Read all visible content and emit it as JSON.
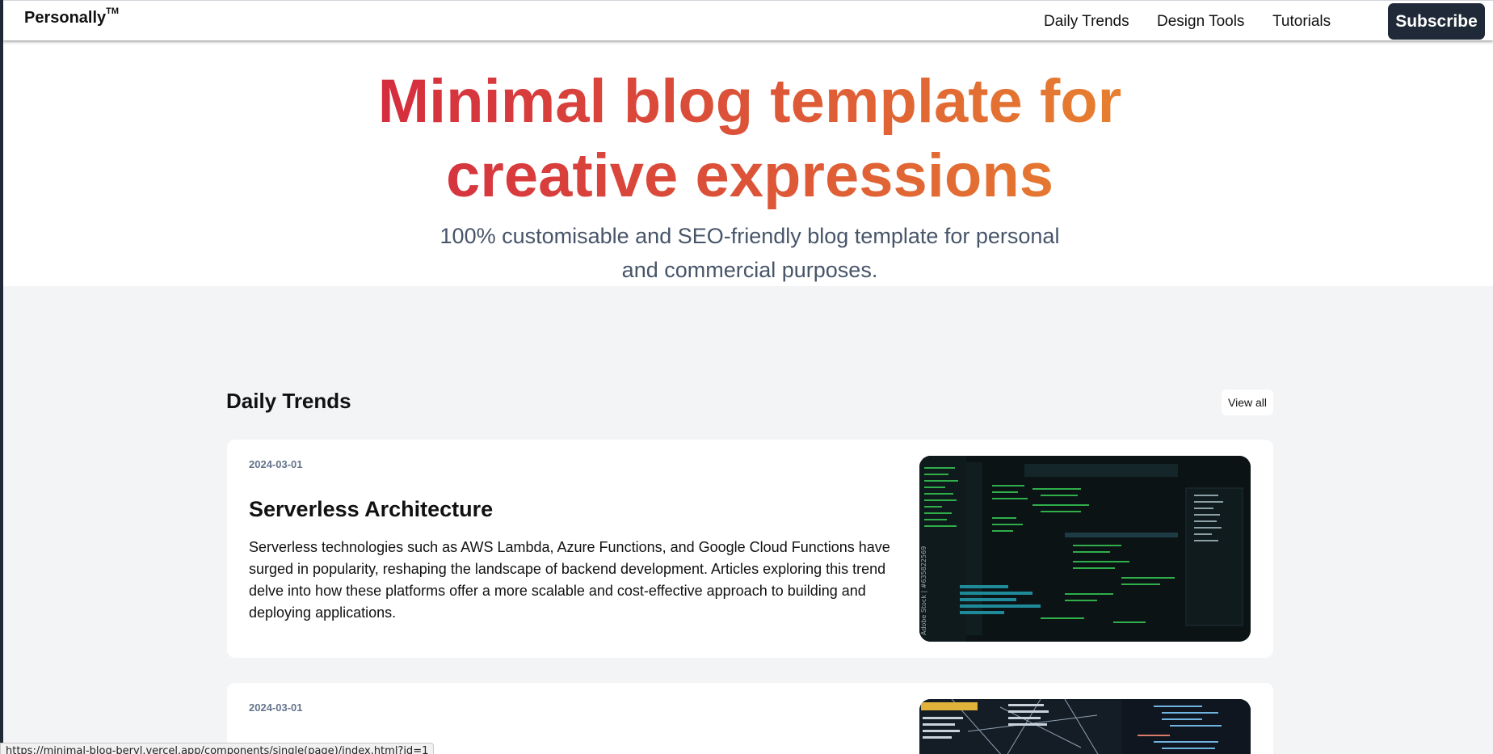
{
  "navbar": {
    "brand": "Personally",
    "brand_mark": "TM",
    "links": [
      "Daily Trends",
      "Design Tools",
      "Tutorials"
    ],
    "subscribe_label": "Subscribe"
  },
  "hero": {
    "title_line1": "Minimal blog template for",
    "title_line2": "creative expressions",
    "subtitle_line1": "100% customisable and SEO-friendly blog template for personal",
    "subtitle_line2": "and commercial purposes."
  },
  "section": {
    "title": "Daily Trends",
    "view_all_label": "View all"
  },
  "posts": [
    {
      "date": "2024-03-01",
      "title": "Serverless Architecture",
      "excerpt": "Serverless technologies such as AWS Lambda, Azure Functions, and Google Cloud Functions have surged in popularity, reshaping the landscape of backend development. Articles exploring this trend delve into how these platforms offer a more scalable and cost-effective approach to building and deploying applications.",
      "image_watermark": "Adobe Stock | #635822569"
    },
    {
      "date": "2024-03-01"
    }
  ],
  "status_bar": {
    "url": "https://minimal-blog-beryl.vercel.app/components/single(page)/index.html?id=1"
  },
  "colors": {
    "gradient_start": "#d42840",
    "gradient_end": "#e8862e",
    "subscribe_bg": "#1f2937",
    "page_bg": "#f3f4f6"
  }
}
